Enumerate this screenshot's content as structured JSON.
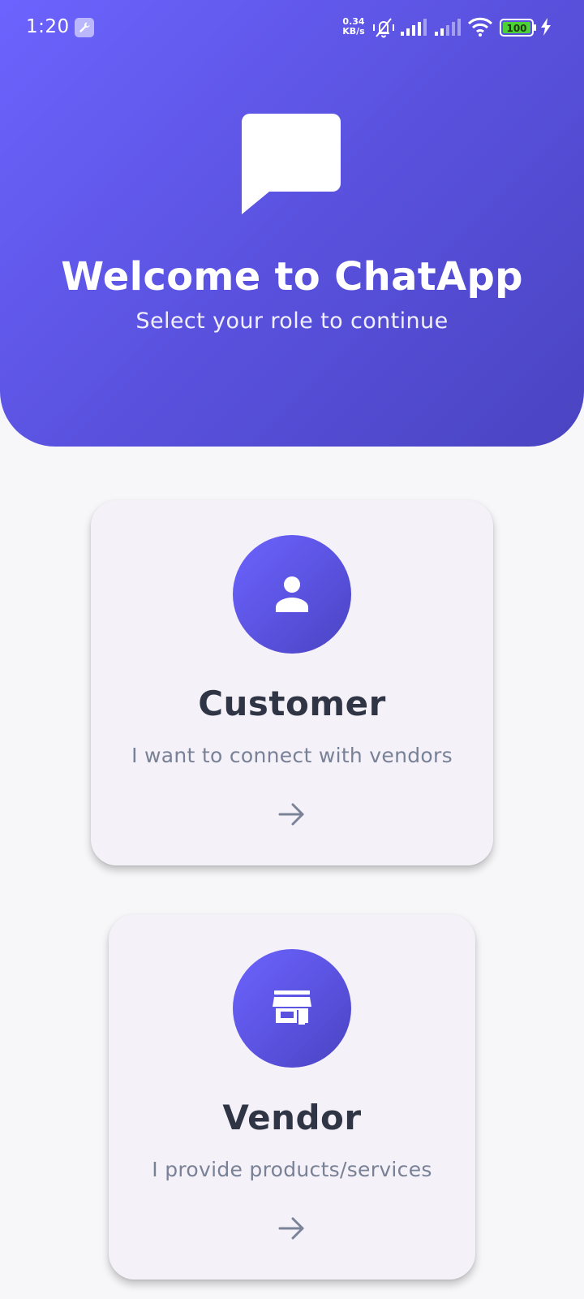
{
  "status_bar": {
    "time": "1:20",
    "net_speed_value": "0.34",
    "net_speed_unit": "KB/s",
    "battery": "100"
  },
  "header": {
    "title": "Welcome to ChatApp",
    "subtitle": "Select your role to continue"
  },
  "roles": [
    {
      "title": "Customer",
      "description": "I want to connect with vendors",
      "icon": "person-icon"
    },
    {
      "title": "Vendor",
      "description": "I provide products/services",
      "icon": "store-icon"
    }
  ],
  "colors": {
    "gradient_start": "#6c63fe",
    "gradient_end": "#4a44c2",
    "card_background": "#f5f1f8",
    "title_text": "#2f3545",
    "muted_text": "#788196",
    "battery_green": "#4cd137"
  }
}
